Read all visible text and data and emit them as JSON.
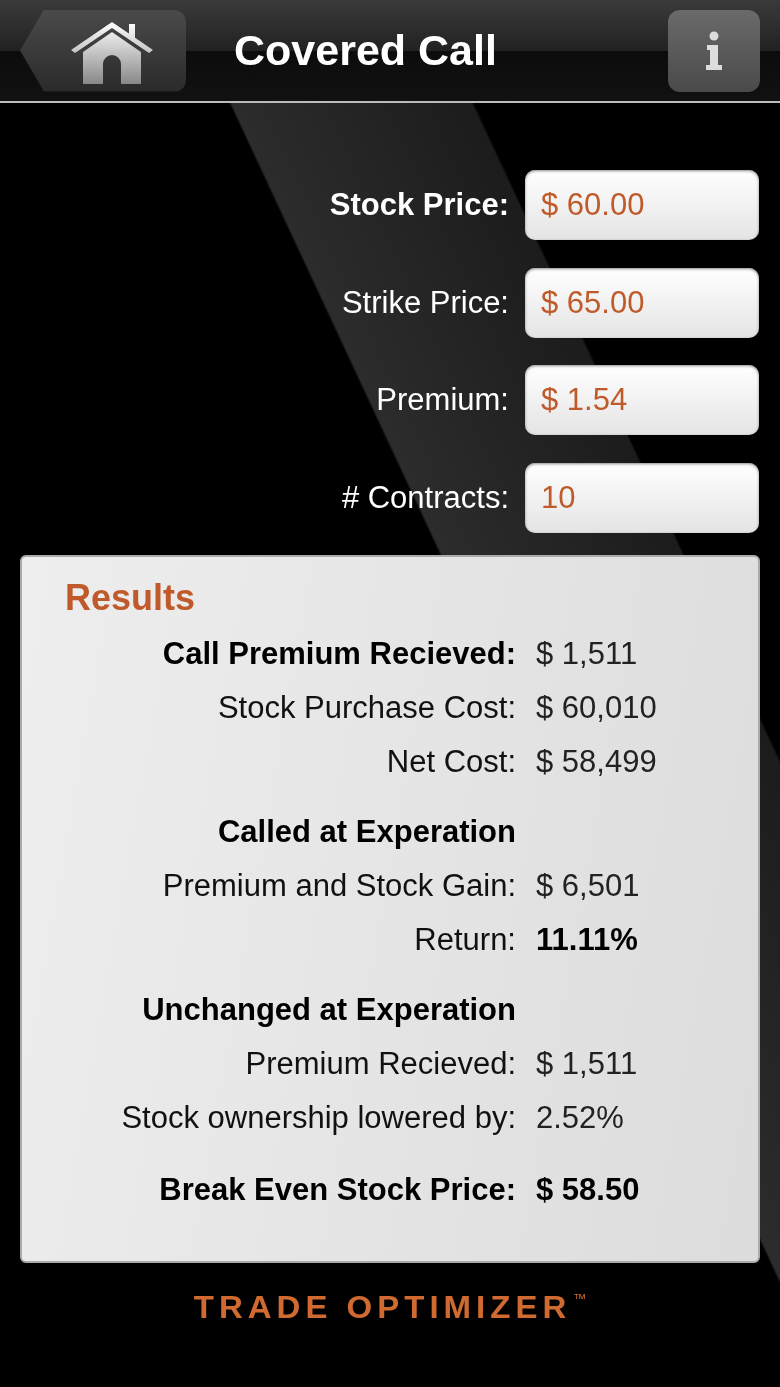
{
  "header": {
    "title": "Covered Call"
  },
  "inputs": [
    {
      "label": "Stock Price:",
      "value": "$ 60.00",
      "focused": true
    },
    {
      "label": "Strike Price:",
      "value": "$ 65.00",
      "focused": false
    },
    {
      "label": "Premium:",
      "value": "$ 1.54",
      "focused": false
    },
    {
      "label": "# Contracts:",
      "value": "10",
      "focused": false
    }
  ],
  "results": {
    "title": "Results",
    "rows": [
      {
        "kind": "row",
        "label": "Call Premium Recieved:",
        "value": "$ 1,511",
        "bold_label": true,
        "bold_value": false
      },
      {
        "kind": "row",
        "label": "Stock Purchase Cost:",
        "value": "$ 60,010",
        "bold_label": false,
        "bold_value": false
      },
      {
        "kind": "row",
        "label": "Net Cost:",
        "value": "$ 58,499",
        "bold_label": false,
        "bold_value": false
      },
      {
        "kind": "heading",
        "label": "Called at Experation"
      },
      {
        "kind": "row",
        "label": "Premium and Stock Gain:",
        "value": "$ 6,501",
        "bold_label": false,
        "bold_value": false
      },
      {
        "kind": "row",
        "label": "Return:",
        "value": "11.11%",
        "bold_label": false,
        "bold_value": true
      },
      {
        "kind": "heading",
        "label": "Unchanged at Experation"
      },
      {
        "kind": "row",
        "label": "Premium Recieved:",
        "value": "$ 1,511",
        "bold_label": false,
        "bold_value": false
      },
      {
        "kind": "row",
        "label": "Stock ownership lowered by:",
        "value": "2.52%",
        "bold_label": false,
        "bold_value": false
      },
      {
        "kind": "total",
        "label": "Break Even Stock Price:",
        "value": "$ 58.50",
        "bold_label": true,
        "bold_value": true
      }
    ]
  },
  "footer": {
    "logo": "TRADE OPTIMIZER",
    "trademark": "™"
  }
}
